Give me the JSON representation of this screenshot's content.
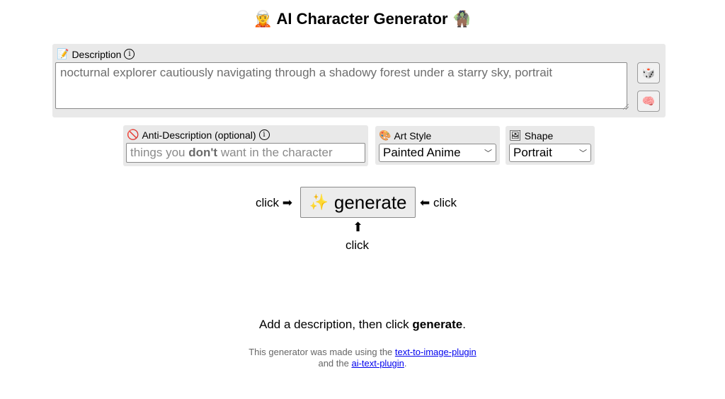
{
  "header": {
    "title": "AI Character Generator",
    "icon_left": "🧝",
    "icon_right": "🧌"
  },
  "description": {
    "icon": "📝",
    "label": "Description",
    "info_icon": "ⓘ",
    "value": "nocturnal explorer cautiously navigating through a shadowy forest under a starry sky, portrait",
    "random_button_icon": "🎲",
    "brain_button_icon": "🧠"
  },
  "anti_description": {
    "icon": "🚫",
    "label": "Anti-Description (optional)",
    "info_icon": "ⓘ",
    "placeholder_pre": "things you ",
    "placeholder_bold": "don't",
    "placeholder_post": " want in the character"
  },
  "art_style": {
    "icon": "🎨",
    "label": "Art Style",
    "selected": "Painted Anime"
  },
  "shape": {
    "icon": "🖼",
    "label": "Shape",
    "selected": "Portrait"
  },
  "generate": {
    "icon": "✨",
    "label": "generate",
    "click_left": "click ➡",
    "click_right": "⬅ click",
    "click_below": "click",
    "up_arrow": "⬆"
  },
  "status": {
    "pre": "Add a description, then click ",
    "bold": "generate",
    "post": "."
  },
  "credits": {
    "line1_pre": "This generator was made using the ",
    "link1": "text-to-image-plugin",
    "line2_pre": "and the ",
    "link2": "ai-text-plugin",
    "line2_post": "."
  },
  "colors": {
    "panel_bg": "#e9e9e9",
    "link": "#0000ee"
  }
}
